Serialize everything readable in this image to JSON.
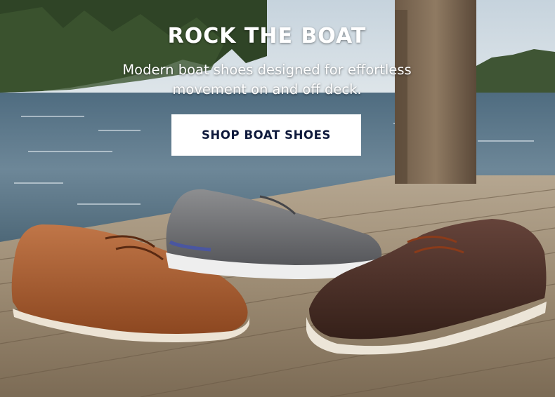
{
  "hero": {
    "headline": "ROCK THE BOAT",
    "subheadline": "Modern boat shoes designed for effortless movement on and off deck.",
    "cta_label": "SHOP BOAT SHOES"
  },
  "colors": {
    "cta_background": "#ffffff",
    "cta_text": "#0f1a3c",
    "headline_text": "#ffffff"
  },
  "products": [
    {
      "name": "tan-leather-boat-shoe",
      "color": "#a35a2c"
    },
    {
      "name": "grey-mesh-boat-shoe",
      "color": "#6d6d70"
    },
    {
      "name": "brown-leather-boat-shoe",
      "color": "#4a2e24"
    }
  ]
}
